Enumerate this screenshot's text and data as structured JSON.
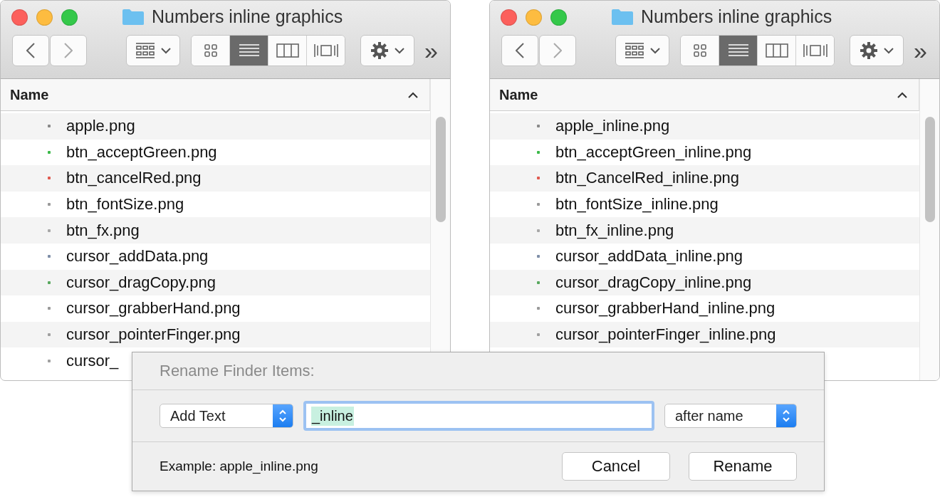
{
  "windows": [
    {
      "title": "Numbers inline graphics",
      "views": [
        {
          "kind": "icons",
          "selected": false
        },
        {
          "kind": "list",
          "selected": true
        },
        {
          "kind": "columns",
          "selected": false
        },
        {
          "kind": "coverflow",
          "selected": false
        }
      ],
      "overflow": "»",
      "column": {
        "label": "Name"
      },
      "files": [
        {
          "name": "apple.png",
          "color": "#8a8a8a"
        },
        {
          "name": "btn_acceptGreen.png",
          "color": "#3cb94a"
        },
        {
          "name": "btn_cancelRed.png",
          "color": "#e05a50"
        },
        {
          "name": "btn_fontSize.png",
          "color": "#9a9a9a"
        },
        {
          "name": "btn_fx.png",
          "color": "#a8a8a8"
        },
        {
          "name": "cursor_addData.png",
          "color": "#7f8fa8"
        },
        {
          "name": "cursor_dragCopy.png",
          "color": "#58a85e"
        },
        {
          "name": "cursor_grabberHand.png",
          "color": "#9a9a9a"
        },
        {
          "name": "cursor_pointerFinger.png",
          "color": "#a0a0a0"
        },
        {
          "name": "cursor_",
          "color": "#a0a0a0"
        }
      ]
    },
    {
      "title": "Numbers inline graphics",
      "views": [
        {
          "kind": "icons",
          "selected": false
        },
        {
          "kind": "list",
          "selected": true
        },
        {
          "kind": "columns",
          "selected": false
        },
        {
          "kind": "coverflow",
          "selected": false
        }
      ],
      "overflow": "»",
      "column": {
        "label": "Name"
      },
      "files": [
        {
          "name": "apple_inline.png",
          "color": "#8a8a8a"
        },
        {
          "name": "btn_acceptGreen_inline.png",
          "color": "#3cb94a"
        },
        {
          "name": "btn_CancelRed_inline.png",
          "color": "#e05a50"
        },
        {
          "name": "btn_fontSize_inline.png",
          "color": "#9a9a9a"
        },
        {
          "name": "btn_fx_inline.png",
          "color": "#a8a8a8"
        },
        {
          "name": "cursor_addData_inline.png",
          "color": "#7f8fa8"
        },
        {
          "name": "cursor_dragCopy_inline.png",
          "color": "#58a85e"
        },
        {
          "name": "cursor_grabberHand_inline.png",
          "color": "#9a9a9a"
        },
        {
          "name": "cursor_pointerFinger_inline.png",
          "color": "#a0a0a0"
        }
      ]
    }
  ],
  "dialog": {
    "title": "Rename Finder Items:",
    "action": "Add Text",
    "text": {
      "value": "_inline"
    },
    "position": "after name",
    "example": "Example: apple_inline.png",
    "buttons": [
      "Cancel",
      "Rename"
    ]
  }
}
